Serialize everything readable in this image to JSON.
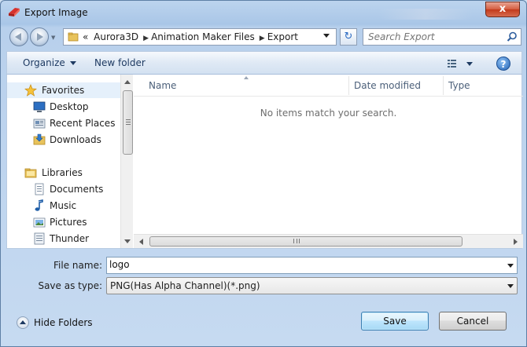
{
  "window": {
    "title": "Export Image",
    "close_label": "x"
  },
  "navbar": {
    "breadcrumb_prefix": "«",
    "breadcrumbs": [
      "Aurora3D",
      "Animation Maker Files",
      "Export"
    ],
    "search_placeholder": "Search Export",
    "refresh_glyph": "↻"
  },
  "toolbar": {
    "organize_label": "Organize",
    "new_folder_label": "New folder",
    "help_label": "?"
  },
  "nav_pane": {
    "items": [
      {
        "label": "Favorites",
        "icon": "star-icon",
        "group": true
      },
      {
        "label": "Desktop",
        "icon": "desktop-icon",
        "group": false
      },
      {
        "label": "Recent Places",
        "icon": "recent-places-icon",
        "group": false
      },
      {
        "label": "Downloads",
        "icon": "downloads-icon",
        "group": false
      },
      {
        "label": "Libraries",
        "icon": "libraries-icon",
        "group": true
      },
      {
        "label": "Documents",
        "icon": "documents-icon",
        "group": false
      },
      {
        "label": "Music",
        "icon": "music-icon",
        "group": false
      },
      {
        "label": "Pictures",
        "icon": "pictures-icon",
        "group": false
      },
      {
        "label": "Thunder",
        "icon": "thunder-icon",
        "group": false
      }
    ]
  },
  "file_pane": {
    "columns": [
      "Name",
      "Date modified",
      "Type"
    ],
    "empty_message": "No items match your search."
  },
  "form": {
    "file_name_label": "File name:",
    "file_name_value": "logo",
    "save_type_label": "Save as type:",
    "save_type_value": "PNG(Has Alpha Channel)(*.png)"
  },
  "footer": {
    "hide_folders_label": "Hide Folders",
    "save_label": "Save",
    "cancel_label": "Cancel"
  },
  "colors": {
    "accent": "#3c7fb1",
    "window_frame": "#bcd4ee",
    "close_red": "#c23a1b"
  }
}
